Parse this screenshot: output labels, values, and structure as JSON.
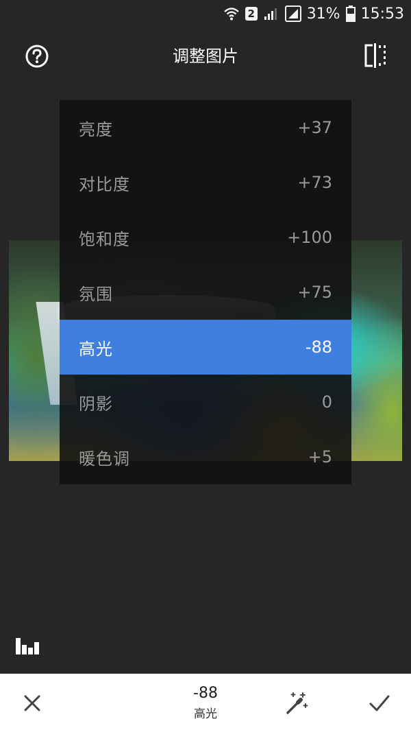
{
  "status_bar": {
    "sim_slot": "2",
    "battery": "31%",
    "time": "15:53",
    "icons": [
      "wifi-icon",
      "sim-2-badge",
      "signal-icon",
      "signal-icon-2",
      "battery-icon"
    ]
  },
  "header": {
    "title": "调整图片",
    "help_icon": "help-circle-icon",
    "compare_icon": "compare-icon"
  },
  "adjustments": [
    {
      "label": "亮度",
      "value": "+37",
      "selected": false
    },
    {
      "label": "对比度",
      "value": "+73",
      "selected": false
    },
    {
      "label": "饱和度",
      "value": "+100",
      "selected": false
    },
    {
      "label": "氛围",
      "value": "+75",
      "selected": false
    },
    {
      "label": "高光",
      "value": "-88",
      "selected": true
    },
    {
      "label": "阴影",
      "value": "0",
      "selected": false
    },
    {
      "label": "暖色调",
      "value": "+5",
      "selected": false
    }
  ],
  "bottom_bar": {
    "current_value": "-88",
    "current_label": "高光",
    "cancel_icon": "close-icon",
    "auto_icon": "magic-wand-icon",
    "apply_icon": "check-icon"
  },
  "colors": {
    "background": "#262626",
    "selected": "#3f7fe0",
    "bottom_bar": "#ffffff"
  }
}
